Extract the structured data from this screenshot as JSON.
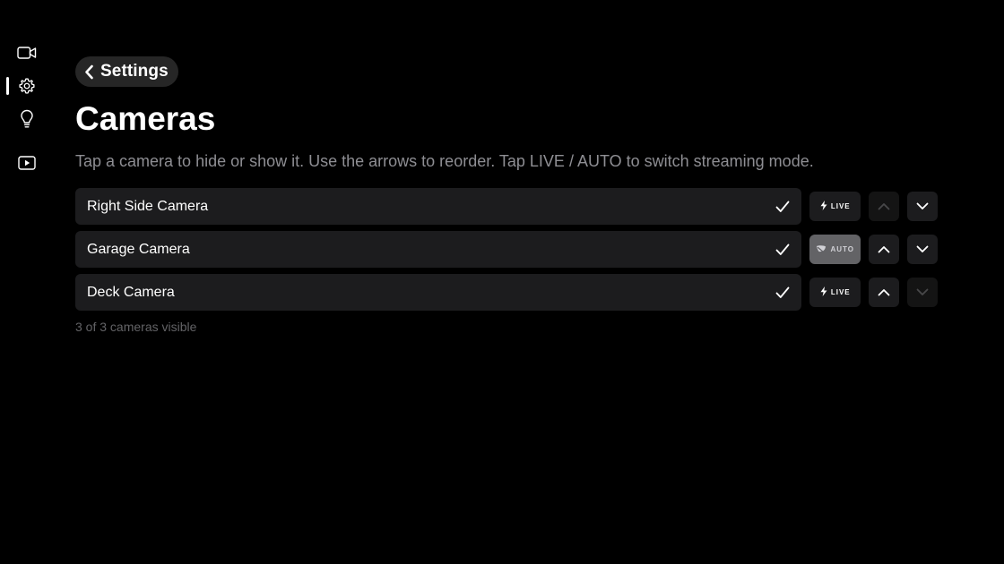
{
  "sidebar": {
    "items": [
      {
        "icon": "video-camera-icon",
        "active": false
      },
      {
        "icon": "gear-icon",
        "active": true
      },
      {
        "icon": "lightbulb-icon",
        "active": false
      },
      {
        "icon": "play-video-icon",
        "active": false
      }
    ]
  },
  "header": {
    "back_label": "Settings",
    "title": "Cameras",
    "subtitle": "Tap a camera to hide or show it. Use the arrows to reorder. Tap LIVE / AUTO to switch streaming mode."
  },
  "cameras": [
    {
      "name": "Right Side Camera",
      "visible": true,
      "mode": "LIVE",
      "mode_icon": "lightning-bolt-icon",
      "up_enabled": false,
      "down_enabled": true
    },
    {
      "name": "Garage Camera",
      "visible": true,
      "mode": "AUTO",
      "mode_icon": "leaf-icon",
      "up_enabled": true,
      "down_enabled": true
    },
    {
      "name": "Deck Camera",
      "visible": true,
      "mode": "LIVE",
      "mode_icon": "lightning-bolt-icon",
      "up_enabled": true,
      "down_enabled": false
    }
  ],
  "footer": {
    "count_text": "3 of 3 cameras visible"
  },
  "colors": {
    "background": "#000000",
    "row": "#1c1c1e",
    "auto_button": "#636366",
    "subtitle": "#8e8e93",
    "muted": "#636366"
  }
}
